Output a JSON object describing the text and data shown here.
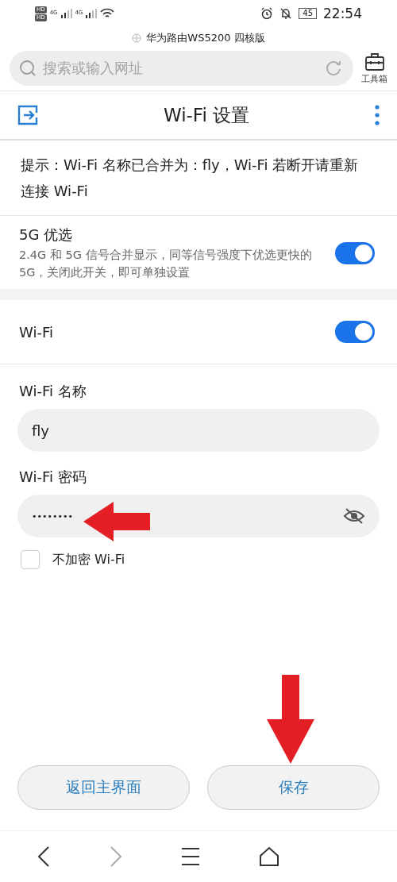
{
  "status_bar": {
    "sim_badges": [
      "HD",
      "HD"
    ],
    "network_labels": [
      "4G",
      "4G"
    ],
    "battery": "45",
    "time": "22:54"
  },
  "browser": {
    "page_title": "华为路由WS5200 四核版",
    "search_placeholder": "搜索或输入网址",
    "toolbox_label": "工具箱"
  },
  "header": {
    "title": "Wi-Fi 设置"
  },
  "notice": "提示：Wi-Fi 名称已合并为：fly，Wi-Fi 若断开请重新连接 Wi-Fi",
  "settings": [
    {
      "kind": "toggle",
      "label": "5G 优选",
      "description": "2.4G 和 5G 信号合并显示，同等信号强度下优选更快的 5G，关闭此开关，即可单独设置",
      "on": true
    },
    {
      "kind": "toggle",
      "label": "Wi-Fi",
      "on": true
    }
  ],
  "fields": [
    {
      "label": "Wi-Fi 名称",
      "value": "fly",
      "kind": "text"
    },
    {
      "label": "Wi-Fi 密码",
      "value": "••••••••",
      "kind": "password"
    }
  ],
  "no_encryption": {
    "label": "不加密 Wi-Fi",
    "checked": false
  },
  "buttons": [
    {
      "label": "返回主界面"
    },
    {
      "label": "保存"
    }
  ]
}
